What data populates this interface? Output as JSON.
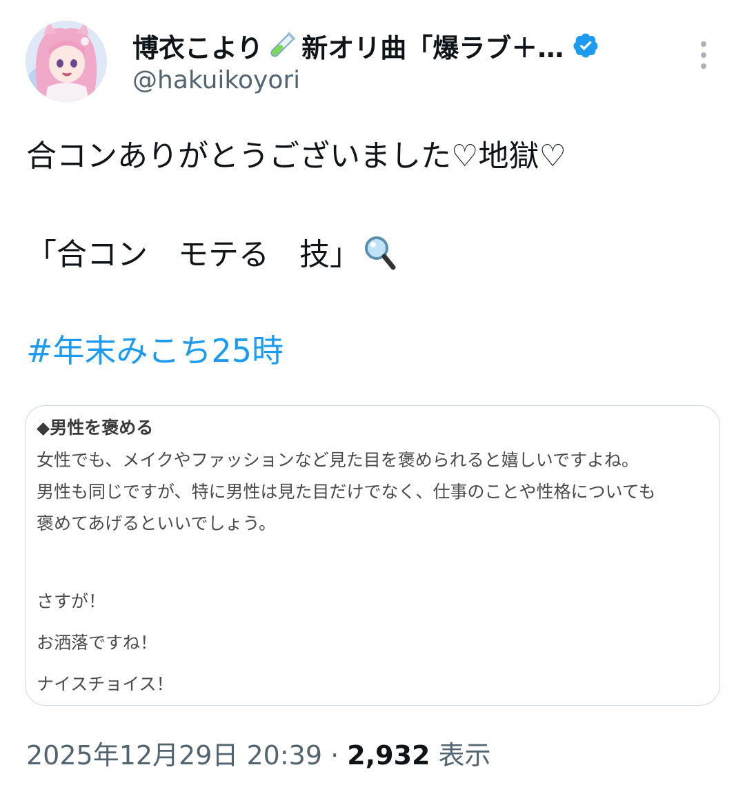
{
  "author": {
    "display_name": "博衣こより",
    "display_name_suffix": "新オリ曲「爆ラブ＋…",
    "handle": "@hakuikoyori",
    "avatar": "anime-avatar-pink-hair",
    "verified_color": "#1d9bf0"
  },
  "tweet": {
    "line1": "合コンありがとうございました♡地獄♡",
    "line2": "「合コン　モテる　技」",
    "hashtag": "#年末みこち25時"
  },
  "media": {
    "heading": "◆男性を褒める",
    "paragraph": [
      "女性でも、メイクやファッションなど見た目を褒められると嬉しいですよね。",
      "男性も同じですが、特に男性は見た目だけでなく、仕事のことや性格についても",
      "褒めてあげるといいでしょう。"
    ],
    "phrases": [
      "さすが！",
      "お洒落ですね！",
      "ナイスチョイス！"
    ]
  },
  "meta": {
    "timestamp": "2025年12月29日 20:39",
    "separator": " · ",
    "views": "2,932",
    "views_label": " 表示"
  },
  "colors": {
    "link": "#1d9bf0",
    "secondary_text": "#536471"
  }
}
